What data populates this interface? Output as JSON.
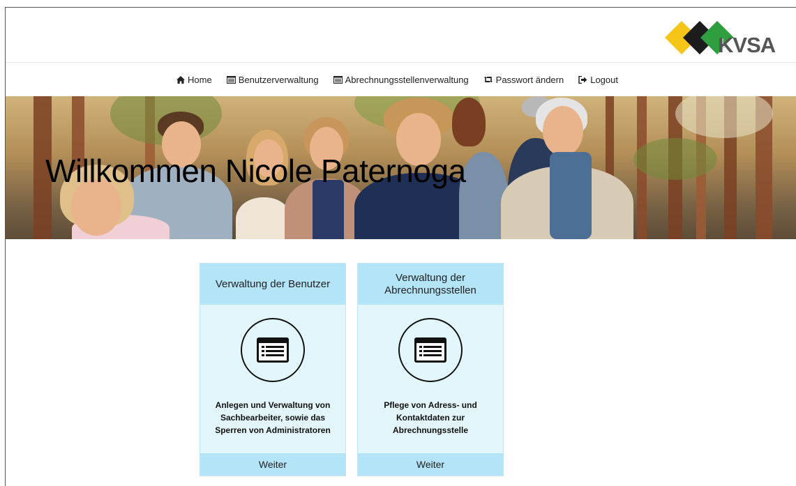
{
  "brand": {
    "logo_text": "KVSA",
    "colors": {
      "yellow": "#f5c518",
      "black": "#1c1c1c",
      "green": "#2e9e3e"
    }
  },
  "nav": {
    "items": [
      {
        "label": "Home",
        "icon": "home-icon"
      },
      {
        "label": "Benutzerverwaltung",
        "icon": "list-icon"
      },
      {
        "label": "Abrechnungsstellenverwaltung",
        "icon": "list-icon"
      },
      {
        "label": "Passwort ändern",
        "icon": "retweet-icon"
      },
      {
        "label": "Logout",
        "icon": "logout-icon"
      }
    ]
  },
  "hero": {
    "title": "Willkommen Nicole Paternoga"
  },
  "cards": [
    {
      "title": "Verwaltung der Benutzer",
      "icon": "list-icon",
      "description": "Anlegen und Verwaltung von Sachbearbeiter, sowie das Sperren von Administratoren",
      "button": "Weiter"
    },
    {
      "title": "Verwaltung der Abrechnungsstellen",
      "icon": "list-icon",
      "description": "Pflege von Adress- und Kontaktdaten zur Abrechnungsstelle",
      "button": "Weiter"
    }
  ]
}
